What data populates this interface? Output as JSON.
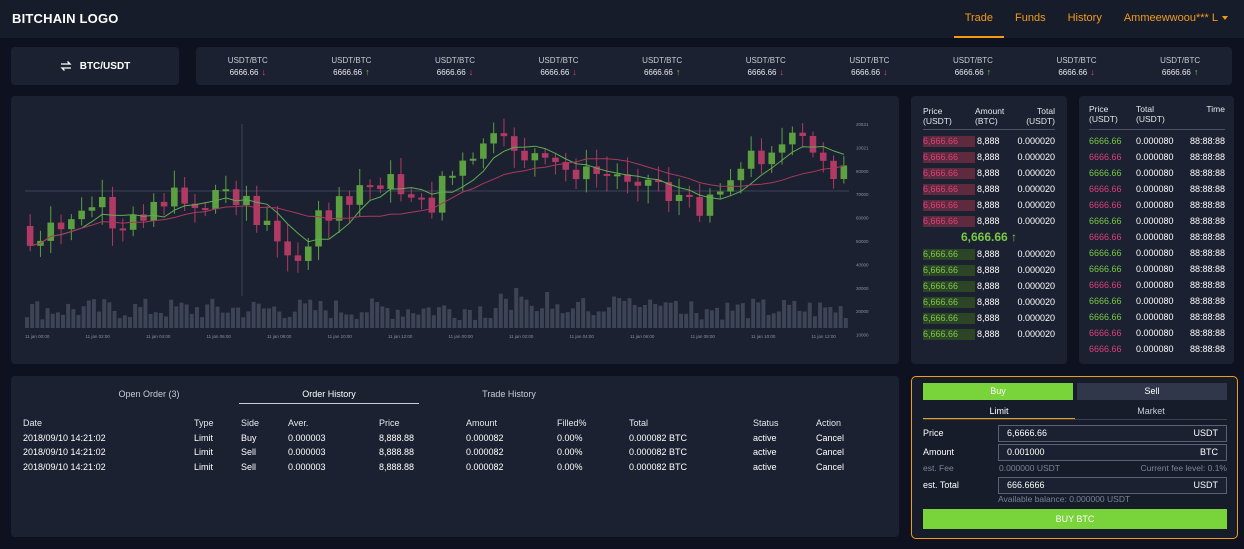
{
  "header": {
    "logo": "BITCHAIN LOGO",
    "nav": [
      {
        "label": "Trade",
        "active": true
      },
      {
        "label": "Funds",
        "active": false
      },
      {
        "label": "History",
        "active": false
      }
    ],
    "user": "Ammeewwoou*** L"
  },
  "pair": {
    "label": "BTC/USDT",
    "icon": "swap-arrows-icon"
  },
  "ticker": [
    {
      "pair": "USDT/BTC",
      "value": "6666.66",
      "dir": "down"
    },
    {
      "pair": "USDT/BTC",
      "value": "6666.66",
      "dir": "up"
    },
    {
      "pair": "USDT/BTC",
      "value": "6666.66",
      "dir": "down"
    },
    {
      "pair": "USDT/BTC",
      "value": "6666.66",
      "dir": "down"
    },
    {
      "pair": "USDT/BTC",
      "value": "6666.66",
      "dir": "up"
    },
    {
      "pair": "USDT/BTC",
      "value": "6666.66",
      "dir": "down"
    },
    {
      "pair": "USDT/BTC",
      "value": "6666.66",
      "dir": "down"
    },
    {
      "pair": "USDT/BTC",
      "value": "6666.66",
      "dir": "up"
    },
    {
      "pair": "USDT/BTC",
      "value": "6666.66",
      "dir": "down"
    },
    {
      "pair": "USDT/BTC",
      "value": "6666.66",
      "dir": "up"
    }
  ],
  "chart": {
    "price_ticks": [
      "20531",
      "10021",
      "80000",
      "70000",
      "60000",
      "50000",
      "40000",
      "30000",
      "20000",
      "10000"
    ],
    "time_ticks": [
      "11 jan 00:00",
      "11 jan 02:00",
      "11 jan 04:00",
      "11 jan 06:00",
      "11 jan 08:00",
      "11 jan 10:00",
      "11 jan 12:00",
      "11 jan 00:00",
      "11 jan 02:00",
      "11 jan 04:00",
      "11 jan 06:00",
      "11 jan 08:00",
      "11 jan 10:00",
      "11 jan 12:00"
    ]
  },
  "orderbook": {
    "headers": {
      "price": "Price\n(USDT)",
      "amount": "Amount\n(BTC)",
      "total": "Total\n(USDT)"
    },
    "price_label": "Price",
    "price_unit": "(USDT)",
    "amount_label": "Amount",
    "amount_unit": "(BTC)",
    "total_label": "Total",
    "total_unit": "(USDT)",
    "asks": [
      {
        "price": "6,666.66",
        "amount": "8,888",
        "total": "0.000020"
      },
      {
        "price": "6,666.66",
        "amount": "8,888",
        "total": "0.000020"
      },
      {
        "price": "6,666.66",
        "amount": "8,888",
        "total": "0.000020"
      },
      {
        "price": "6,666.66",
        "amount": "8,888",
        "total": "0.000020"
      },
      {
        "price": "6,666.66",
        "amount": "8,888",
        "total": "0.000020"
      },
      {
        "price": "6,666.66",
        "amount": "8,888",
        "total": "0.000020"
      }
    ],
    "mid": "6,666.66 ↑",
    "bids": [
      {
        "price": "6,666.66",
        "amount": "8,888",
        "total": "0.000020"
      },
      {
        "price": "6,666.66",
        "amount": "8,888",
        "total": "0.000020"
      },
      {
        "price": "6,666.66",
        "amount": "8,888",
        "total": "0.000020"
      },
      {
        "price": "6,666.66",
        "amount": "8,888",
        "total": "0.000020"
      },
      {
        "price": "6,666.66",
        "amount": "8,888",
        "total": "0.000020"
      },
      {
        "price": "6,666.66",
        "amount": "8,888",
        "total": "0.000020"
      }
    ]
  },
  "trades": {
    "price_label": "Price",
    "price_unit": "(USDT)",
    "total_label": "Total",
    "total_unit": "(USDT)",
    "time_label": "Time",
    "rows": [
      {
        "price": "6666.66",
        "total": "0.000080",
        "time": "88:88:88",
        "side": "bid"
      },
      {
        "price": "6666.66",
        "total": "0.000080",
        "time": "88:88:88",
        "side": "ask"
      },
      {
        "price": "6666.66",
        "total": "0.000080",
        "time": "88:88:88",
        "side": "bid"
      },
      {
        "price": "6666.66",
        "total": "0.000080",
        "time": "88:88:88",
        "side": "ask"
      },
      {
        "price": "6666.66",
        "total": "0.000080",
        "time": "88:88:88",
        "side": "ask"
      },
      {
        "price": "6666.66",
        "total": "0.000080",
        "time": "88:88:88",
        "side": "bid"
      },
      {
        "price": "6666.66",
        "total": "0.000080",
        "time": "88:88:88",
        "side": "ask"
      },
      {
        "price": "6666.66",
        "total": "0.000080",
        "time": "88:88:88",
        "side": "bid"
      },
      {
        "price": "6666.66",
        "total": "0.000080",
        "time": "88:88:88",
        "side": "bid"
      },
      {
        "price": "6666.66",
        "total": "0.000080",
        "time": "88:88:88",
        "side": "ask"
      },
      {
        "price": "6666.66",
        "total": "0.000080",
        "time": "88:88:88",
        "side": "bid"
      },
      {
        "price": "6666.66",
        "total": "0.000080",
        "time": "88:88:88",
        "side": "bid"
      },
      {
        "price": "6666.66",
        "total": "0.000080",
        "time": "88:88:88",
        "side": "ask"
      },
      {
        "price": "6666.66",
        "total": "0.000080",
        "time": "88:88:88",
        "side": "ask"
      }
    ]
  },
  "orders": {
    "tabs": [
      "Open Order (3)",
      "Order History",
      "Trade History"
    ],
    "active_tab": 1,
    "headers": [
      "Date",
      "Type",
      "Side",
      "Aver.",
      "Price",
      "Amount",
      "Filled%",
      "Total",
      "Status",
      "Action"
    ],
    "rows": [
      [
        "2018/09/10  14:21:02",
        "Limit",
        "Buy",
        "0.000003",
        "8,888.88",
        "0.000082",
        "0.00%",
        "0.000082 BTC",
        "active",
        "Cancel"
      ],
      [
        "2018/09/10  14:21:02",
        "Limit",
        "Sell",
        "0.000003",
        "8,888.88",
        "0.000082",
        "0.00%",
        "0.000082 BTC",
        "active",
        "Cancel"
      ],
      [
        "2018/09/10  14:21:02",
        "Limit",
        "Sell",
        "0.000003",
        "8,888.88",
        "0.000082",
        "0.00%",
        "0.000082 BTC",
        "active",
        "Cancel"
      ]
    ]
  },
  "form": {
    "buy_label": "Buy",
    "sell_label": "Sell",
    "limit_label": "Limit",
    "market_label": "Market",
    "price_label": "Price",
    "price_value": "6,6666.66",
    "price_unit": "USDT",
    "amount_label": "Amount",
    "amount_value": "0.001000",
    "amount_unit": "BTC",
    "fee_label": "est. Fee",
    "fee_value": "0.000000 USDT",
    "fee_level": "Current fee level: 0.1%",
    "total_label": "est. Total",
    "total_value": "666.6666",
    "total_unit": "USDT",
    "available": "Available balance:  0.000000 USDT",
    "submit_label": "BUY BTC"
  },
  "colors": {
    "accent": "#f39c12",
    "up": "#7ac943",
    "down": "#d9427a",
    "panel": "#1b2131",
    "bg": "#0e1220"
  }
}
